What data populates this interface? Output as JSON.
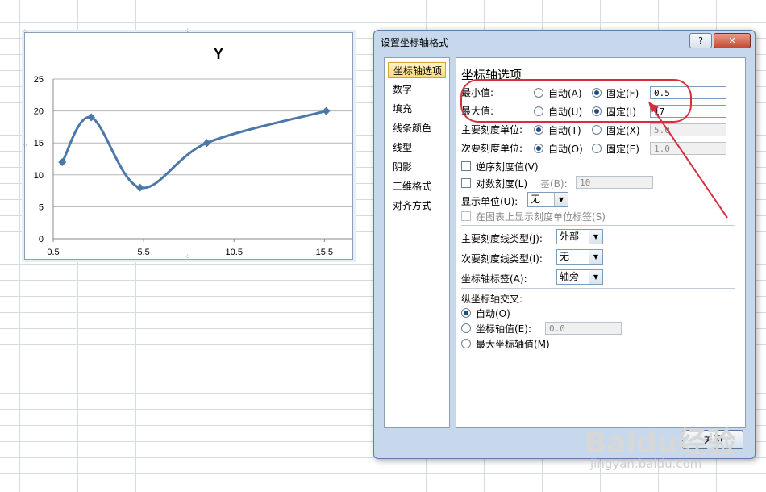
{
  "chart": {
    "title": "Y",
    "series_color": "#4a78a8",
    "chart_data": {
      "type": "scatter",
      "title": "Y",
      "x": [
        1.0,
        2.6,
        5.3,
        9.0,
        15.6
      ],
      "y": [
        12,
        19,
        8,
        15,
        20
      ],
      "xlim": [
        0.5,
        17
      ],
      "ylim": [
        0,
        25
      ],
      "xticks": [
        "0.5",
        "5.5",
        "10.5",
        "15.5"
      ],
      "yticks": [
        "0",
        "5",
        "10",
        "15",
        "20",
        "25"
      ],
      "grid": "horizontal",
      "smoothed": true
    }
  },
  "dialog": {
    "title": "设置坐标轴格式",
    "help_label": "?",
    "close_x": "✕",
    "nav": [
      "坐标轴选项",
      "数字",
      "填充",
      "线条颜色",
      "线型",
      "阴影",
      "三维格式",
      "对齐方式"
    ],
    "section_title": "坐标轴选项",
    "rows": {
      "min": {
        "label": "最小值:",
        "auto": "自动(A)",
        "fixed": "固定(F)",
        "value": "0.5"
      },
      "max": {
        "label": "最大值:",
        "auto": "自动(U)",
        "fixed": "固定(I)",
        "value": "17"
      },
      "major": {
        "label": "主要刻度单位:",
        "auto": "自动(T)",
        "fixed": "固定(X)",
        "value": "5.0"
      },
      "minor": {
        "label": "次要刻度单位:",
        "auto": "自动(O)",
        "fixed": "固定(E)",
        "value": "1.0"
      }
    },
    "reverse_label": "逆序刻度值(V)",
    "log_label": "对数刻度(L)",
    "log_base_label": "基(B):",
    "log_base_value": "10",
    "display_units_label": "显示单位(U):",
    "display_units_value": "无",
    "show_units_label": "在图表上显示刻度单位标签(S)",
    "major_tick_label": "主要刻度线类型(J):",
    "major_tick_value": "外部",
    "minor_tick_label": "次要刻度线类型(I):",
    "minor_tick_value": "无",
    "axis_labels_label": "坐标轴标签(A):",
    "axis_labels_value": "轴旁",
    "cross_label": "纵坐标轴交叉:",
    "cross_auto": "自动(O)",
    "cross_value_label": "坐标轴值(E):",
    "cross_value": "0.0",
    "cross_max": "最大坐标轴值(M)",
    "close_button": "关闭",
    "annotation_color": "#d62f3d"
  },
  "watermark": {
    "logo": "Baidu经验",
    "url": "jingyan.baidu.com"
  }
}
